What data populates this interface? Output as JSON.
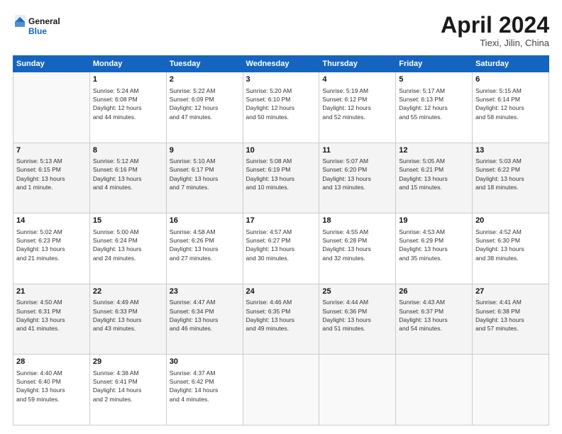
{
  "header": {
    "logo_line1": "General",
    "logo_line2": "Blue",
    "title": "April 2024",
    "subtitle": "Tiexi, Jilin, China"
  },
  "weekdays": [
    "Sunday",
    "Monday",
    "Tuesday",
    "Wednesday",
    "Thursday",
    "Friday",
    "Saturday"
  ],
  "weeks": [
    [
      {
        "day": "",
        "info": ""
      },
      {
        "day": "1",
        "info": "Sunrise: 5:24 AM\nSunset: 6:08 PM\nDaylight: 12 hours\nand 44 minutes."
      },
      {
        "day": "2",
        "info": "Sunrise: 5:22 AM\nSunset: 6:09 PM\nDaylight: 12 hours\nand 47 minutes."
      },
      {
        "day": "3",
        "info": "Sunrise: 5:20 AM\nSunset: 6:10 PM\nDaylight: 12 hours\nand 50 minutes."
      },
      {
        "day": "4",
        "info": "Sunrise: 5:19 AM\nSunset: 6:12 PM\nDaylight: 12 hours\nand 52 minutes."
      },
      {
        "day": "5",
        "info": "Sunrise: 5:17 AM\nSunset: 6:13 PM\nDaylight: 12 hours\nand 55 minutes."
      },
      {
        "day": "6",
        "info": "Sunrise: 5:15 AM\nSunset: 6:14 PM\nDaylight: 12 hours\nand 58 minutes."
      }
    ],
    [
      {
        "day": "7",
        "info": "Sunrise: 5:13 AM\nSunset: 6:15 PM\nDaylight: 13 hours\nand 1 minute."
      },
      {
        "day": "8",
        "info": "Sunrise: 5:12 AM\nSunset: 6:16 PM\nDaylight: 13 hours\nand 4 minutes."
      },
      {
        "day": "9",
        "info": "Sunrise: 5:10 AM\nSunset: 6:17 PM\nDaylight: 13 hours\nand 7 minutes."
      },
      {
        "day": "10",
        "info": "Sunrise: 5:08 AM\nSunset: 6:19 PM\nDaylight: 13 hours\nand 10 minutes."
      },
      {
        "day": "11",
        "info": "Sunrise: 5:07 AM\nSunset: 6:20 PM\nDaylight: 13 hours\nand 13 minutes."
      },
      {
        "day": "12",
        "info": "Sunrise: 5:05 AM\nSunset: 6:21 PM\nDaylight: 13 hours\nand 15 minutes."
      },
      {
        "day": "13",
        "info": "Sunrise: 5:03 AM\nSunset: 6:22 PM\nDaylight: 13 hours\nand 18 minutes."
      }
    ],
    [
      {
        "day": "14",
        "info": "Sunrise: 5:02 AM\nSunset: 6:23 PM\nDaylight: 13 hours\nand 21 minutes."
      },
      {
        "day": "15",
        "info": "Sunrise: 5:00 AM\nSunset: 6:24 PM\nDaylight: 13 hours\nand 24 minutes."
      },
      {
        "day": "16",
        "info": "Sunrise: 4:58 AM\nSunset: 6:26 PM\nDaylight: 13 hours\nand 27 minutes."
      },
      {
        "day": "17",
        "info": "Sunrise: 4:57 AM\nSunset: 6:27 PM\nDaylight: 13 hours\nand 30 minutes."
      },
      {
        "day": "18",
        "info": "Sunrise: 4:55 AM\nSunset: 6:28 PM\nDaylight: 13 hours\nand 32 minutes."
      },
      {
        "day": "19",
        "info": "Sunrise: 4:53 AM\nSunset: 6:29 PM\nDaylight: 13 hours\nand 35 minutes."
      },
      {
        "day": "20",
        "info": "Sunrise: 4:52 AM\nSunset: 6:30 PM\nDaylight: 13 hours\nand 38 minutes."
      }
    ],
    [
      {
        "day": "21",
        "info": "Sunrise: 4:50 AM\nSunset: 6:31 PM\nDaylight: 13 hours\nand 41 minutes."
      },
      {
        "day": "22",
        "info": "Sunrise: 4:49 AM\nSunset: 6:33 PM\nDaylight: 13 hours\nand 43 minutes."
      },
      {
        "day": "23",
        "info": "Sunrise: 4:47 AM\nSunset: 6:34 PM\nDaylight: 13 hours\nand 46 minutes."
      },
      {
        "day": "24",
        "info": "Sunrise: 4:46 AM\nSunset: 6:35 PM\nDaylight: 13 hours\nand 49 minutes."
      },
      {
        "day": "25",
        "info": "Sunrise: 4:44 AM\nSunset: 6:36 PM\nDaylight: 13 hours\nand 51 minutes."
      },
      {
        "day": "26",
        "info": "Sunrise: 4:43 AM\nSunset: 6:37 PM\nDaylight: 13 hours\nand 54 minutes."
      },
      {
        "day": "27",
        "info": "Sunrise: 4:41 AM\nSunset: 6:38 PM\nDaylight: 13 hours\nand 57 minutes."
      }
    ],
    [
      {
        "day": "28",
        "info": "Sunrise: 4:40 AM\nSunset: 6:40 PM\nDaylight: 13 hours\nand 59 minutes."
      },
      {
        "day": "29",
        "info": "Sunrise: 4:38 AM\nSunset: 6:41 PM\nDaylight: 14 hours\nand 2 minutes."
      },
      {
        "day": "30",
        "info": "Sunrise: 4:37 AM\nSunset: 6:42 PM\nDaylight: 14 hours\nand 4 minutes."
      },
      {
        "day": "",
        "info": ""
      },
      {
        "day": "",
        "info": ""
      },
      {
        "day": "",
        "info": ""
      },
      {
        "day": "",
        "info": ""
      }
    ]
  ]
}
